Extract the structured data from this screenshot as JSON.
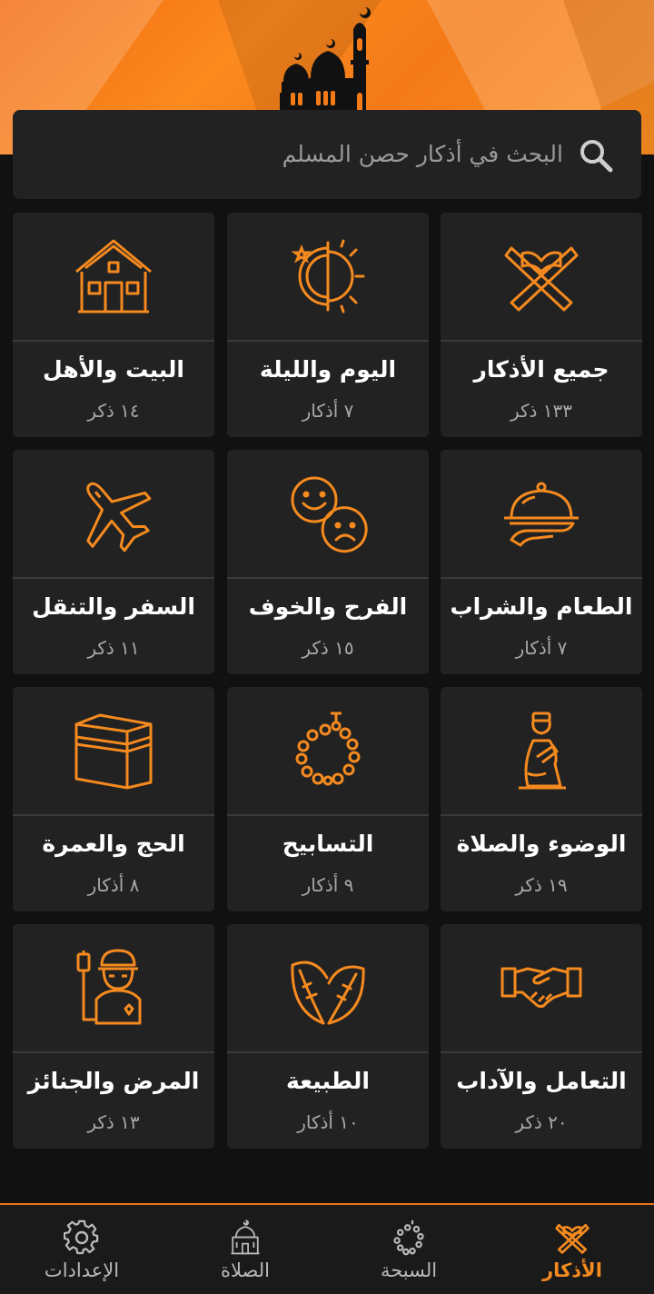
{
  "colors": {
    "accent": "#f58a1f",
    "card_bg": "#222222",
    "background": "#111111"
  },
  "search": {
    "placeholder": "البحث في أذكار حصن المسلم",
    "icon": "search-icon"
  },
  "categories": [
    {
      "title": "جميع الأذكار",
      "count": "١٣٣ ذكر",
      "icon": "quran-stand-icon"
    },
    {
      "title": "اليوم والليلة",
      "count": "٧ أذكار",
      "icon": "day-night-icon"
    },
    {
      "title": "البيت والأهل",
      "count": "١٤ ذكر",
      "icon": "house-icon"
    },
    {
      "title": "الطعام والشراب",
      "count": "٧ أذكار",
      "icon": "food-platter-icon"
    },
    {
      "title": "الفرح والخوف",
      "count": "١٥ ذكر",
      "icon": "happy-sad-faces-icon"
    },
    {
      "title": "السفر والتنقل",
      "count": "١١ ذكر",
      "icon": "airplane-icon"
    },
    {
      "title": "الوضوء والصلاة",
      "count": "١٩ ذكر",
      "icon": "praying-man-icon"
    },
    {
      "title": "التسابيح",
      "count": "٩ أذكار",
      "icon": "prayer-beads-icon"
    },
    {
      "title": "الحج والعمرة",
      "count": "٨ أذكار",
      "icon": "kaaba-icon"
    },
    {
      "title": "التعامل والآداب",
      "count": "٢٠ ذكر",
      "icon": "handshake-icon"
    },
    {
      "title": "الطبيعة",
      "count": "١٠ أذكار",
      "icon": "leaves-icon"
    },
    {
      "title": "المرض والجنائز",
      "count": "١٣ ذكر",
      "icon": "sick-patient-icon"
    }
  ],
  "nav": [
    {
      "label": "الأذكار",
      "icon": "quran-stand-icon",
      "active": true
    },
    {
      "label": "السبحة",
      "icon": "prayer-beads-icon",
      "active": false
    },
    {
      "label": "الصلاة",
      "icon": "mosque-icon",
      "active": false
    },
    {
      "label": "الإعدادات",
      "icon": "gear-icon",
      "active": false
    }
  ]
}
